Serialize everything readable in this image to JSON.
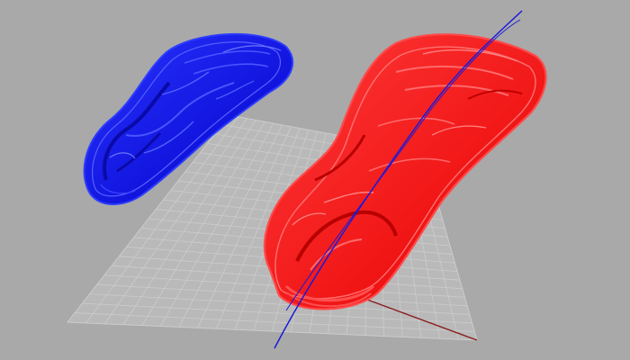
{
  "viewport": {
    "view_type": "perspective",
    "background_color": "#a9a9a9",
    "grid_visible": true,
    "grid_line_color": "#cccccc"
  },
  "objects": [
    {
      "name": "shoe-sole-blue",
      "color": "#0a16f0",
      "selected": false
    },
    {
      "name": "shoe-sole-red",
      "color": "#ff1a1a",
      "selected": true
    }
  ],
  "curve": {
    "name": "section-curve",
    "color": "#1a1ad8"
  },
  "axes": {
    "x_color": "#8b1c1c",
    "y_color": "#1c7a1c"
  }
}
